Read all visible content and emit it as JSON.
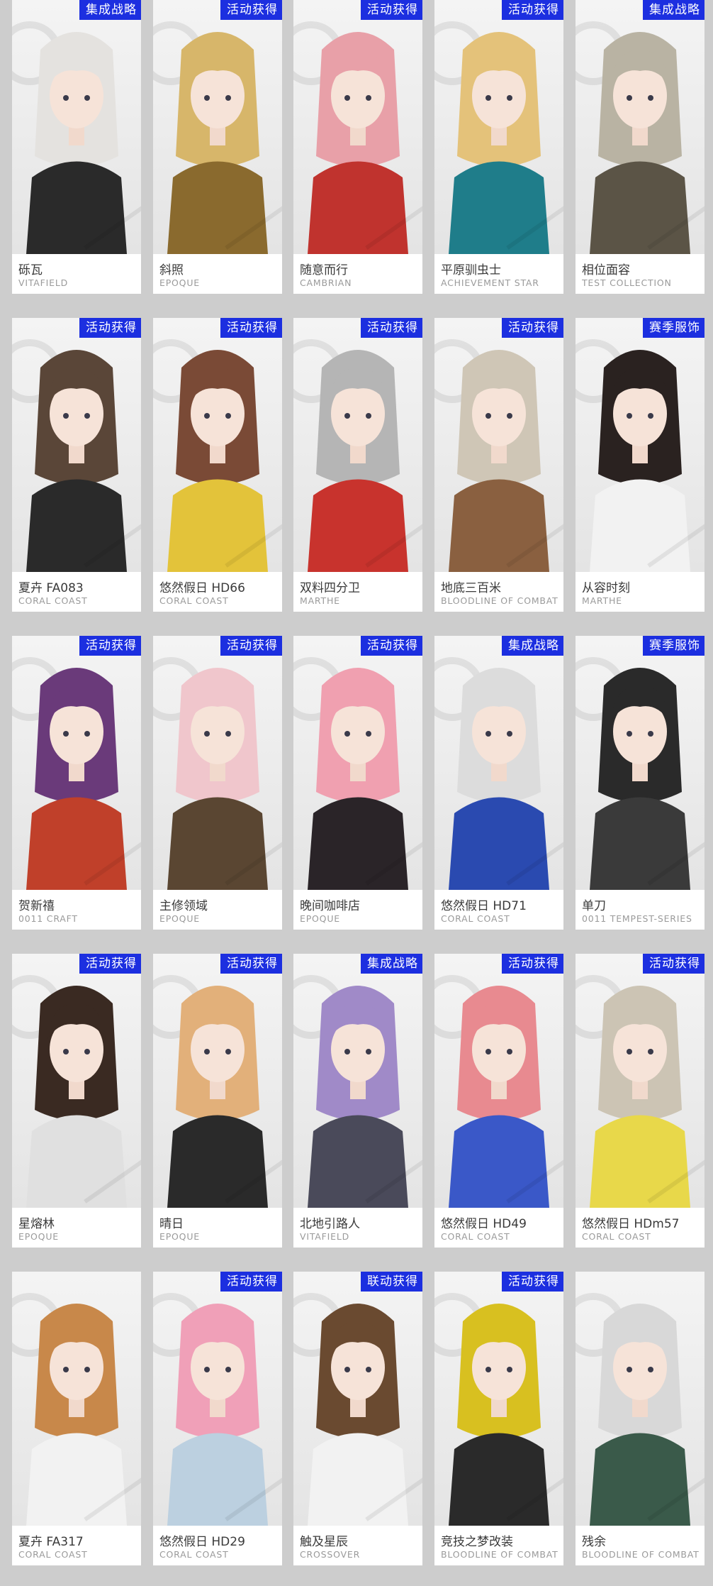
{
  "colors": {
    "badge_bg": "#1c2fe0",
    "page_bg": "#cdcdcd"
  },
  "outfits": [
    {
      "name": "砾瓦",
      "brand": "VITAFIELD",
      "badge": "集成战略",
      "hair": "#e4e2df",
      "outfit": "#2a2a2a",
      "icon": "character-portrait-icon"
    },
    {
      "name": "斜照",
      "brand": "EPOQUE",
      "badge": "活动获得",
      "hair": "#d7b66a",
      "outfit": "#8a6a2e",
      "icon": "character-portrait-icon"
    },
    {
      "name": "随意而行",
      "brand": "CAMBRIAN",
      "badge": "活动获得",
      "hair": "#e8a0a8",
      "outfit": "#c0332e",
      "icon": "character-portrait-icon"
    },
    {
      "name": "平原驯虫士",
      "brand": "ACHIEVEMENT STAR",
      "badge": "活动获得",
      "hair": "#e4c27a",
      "outfit": "#1f7d8a",
      "icon": "character-portrait-icon"
    },
    {
      "name": "相位面容",
      "brand": "TEST COLLECTION",
      "badge": "集成战略",
      "hair": "#b9b3a3",
      "outfit": "#5b5446",
      "icon": "character-portrait-icon"
    },
    {
      "name": "夏卉 FA083",
      "brand": "CORAL COAST",
      "badge": "活动获得",
      "hair": "#5a4638",
      "outfit": "#2a2a2a",
      "icon": "character-portrait-icon"
    },
    {
      "name": "悠然假日 HD66",
      "brand": "CORAL COAST",
      "badge": "活动获得",
      "hair": "#7a4a36",
      "outfit": "#e3c33a",
      "icon": "character-portrait-icon"
    },
    {
      "name": "双料四分卫",
      "brand": "MARTHE",
      "badge": "活动获得",
      "hair": "#b5b5b5",
      "outfit": "#c8332d",
      "icon": "character-portrait-icon"
    },
    {
      "name": "地底三百米",
      "brand": "BLOODLINE OF COMBAT",
      "badge": "活动获得",
      "hair": "#cfc6b6",
      "outfit": "#8a6040",
      "icon": "character-portrait-icon"
    },
    {
      "name": "从容时刻",
      "brand": "MARTHE",
      "badge": "赛季服饰",
      "hair": "#2a2220",
      "outfit": "#f2f2f2",
      "icon": "character-portrait-icon"
    },
    {
      "name": "贺新禧",
      "brand": "0011 CRAFT",
      "badge": "活动获得",
      "hair": "#6a3a7a",
      "outfit": "#c0402a",
      "icon": "character-portrait-icon"
    },
    {
      "name": "主修领域",
      "brand": "EPOQUE",
      "badge": "活动获得",
      "hair": "#f0c6cc",
      "outfit": "#5a4632",
      "icon": "character-portrait-icon"
    },
    {
      "name": "晚间咖啡店",
      "brand": "EPOQUE",
      "badge": "活动获得",
      "hair": "#f0a0b0",
      "outfit": "#2a2428",
      "icon": "character-portrait-icon"
    },
    {
      "name": "悠然假日 HD71",
      "brand": "CORAL COAST",
      "badge": "集成战略",
      "hair": "#dcdcdc",
      "outfit": "#2a4ab0",
      "icon": "character-portrait-icon"
    },
    {
      "name": "单刀",
      "brand": "0011 TEMPEST-SERIES",
      "badge": "赛季服饰",
      "hair": "#2a2a2a",
      "outfit": "#3a3a3a",
      "icon": "character-portrait-icon"
    },
    {
      "name": "星熔林",
      "brand": "EPOQUE",
      "badge": "活动获得",
      "hair": "#3a2a22",
      "outfit": "#e0e0e0",
      "icon": "character-portrait-icon"
    },
    {
      "name": "晴日",
      "brand": "EPOQUE",
      "badge": "活动获得",
      "hair": "#e2b07a",
      "outfit": "#2a2a2a",
      "icon": "character-portrait-icon"
    },
    {
      "name": "北地引路人",
      "brand": "VITAFIELD",
      "badge": "集成战略",
      "hair": "#a08ac8",
      "outfit": "#4a4a5a",
      "icon": "character-portrait-icon"
    },
    {
      "name": "悠然假日 HD49",
      "brand": "CORAL COAST",
      "badge": "活动获得",
      "hair": "#e88a90",
      "outfit": "#3a58c8",
      "icon": "character-portrait-icon"
    },
    {
      "name": "悠然假日 HDm57",
      "brand": "CORAL COAST",
      "badge": "活动获得",
      "hair": "#ccc4b4",
      "outfit": "#e8d84a",
      "icon": "character-portrait-icon"
    },
    {
      "name": "夏卉 FA317",
      "brand": "CORAL COAST",
      "badge": "",
      "hair": "#c8884a",
      "outfit": "#f2f2f2",
      "icon": "character-portrait-icon"
    },
    {
      "name": "悠然假日 HD29",
      "brand": "CORAL COAST",
      "badge": "活动获得",
      "hair": "#f0a0b8",
      "outfit": "#bcd0e0",
      "icon": "character-portrait-icon"
    },
    {
      "name": "触及星辰",
      "brand": "CROSSOVER",
      "badge": "联动获得",
      "hair": "#6a4a30",
      "outfit": "#f2f2f2",
      "icon": "character-portrait-icon"
    },
    {
      "name": "竞技之梦改装",
      "brand": "BLOODLINE OF COMBAT",
      "badge": "活动获得",
      "hair": "#d8c020",
      "outfit": "#2a2a2a",
      "icon": "character-portrait-icon"
    },
    {
      "name": "残余",
      "brand": "BLOODLINE OF COMBAT",
      "badge": "",
      "hair": "#d8d8d8",
      "outfit": "#3a5a4a",
      "icon": "character-portrait-icon"
    }
  ]
}
